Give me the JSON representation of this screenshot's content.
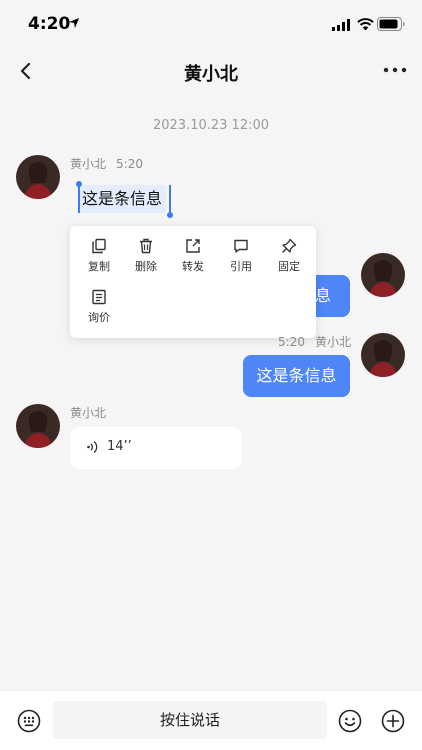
{
  "status_bar": {
    "time": "4:20"
  },
  "header": {
    "title": "黄小北"
  },
  "chat": {
    "timestamp": "2023.10.23 12:00",
    "messages": [
      {
        "sender": "黄小北",
        "time": "5:20",
        "text": "这是条信息"
      },
      {
        "text_partial": "息"
      },
      {
        "sender": "黄小北",
        "time": "5:20",
        "text": "这是条信息"
      },
      {
        "sender": "黄小北",
        "duration": "14’’"
      }
    ]
  },
  "context_menu": {
    "items": [
      {
        "label": "复制",
        "icon": "copy-icon"
      },
      {
        "label": "删除",
        "icon": "trash-icon"
      },
      {
        "label": "转发",
        "icon": "forward-icon"
      },
      {
        "label": "引用",
        "icon": "quote-icon"
      },
      {
        "label": "固定",
        "icon": "pin-icon"
      },
      {
        "label": "询价",
        "icon": "inquiry-icon"
      }
    ]
  },
  "input_bar": {
    "hold_to_talk": "按住说话"
  },
  "colors": {
    "accent": "#4f86f7",
    "background": "#f5f5f5",
    "selection": "#e3edff"
  }
}
